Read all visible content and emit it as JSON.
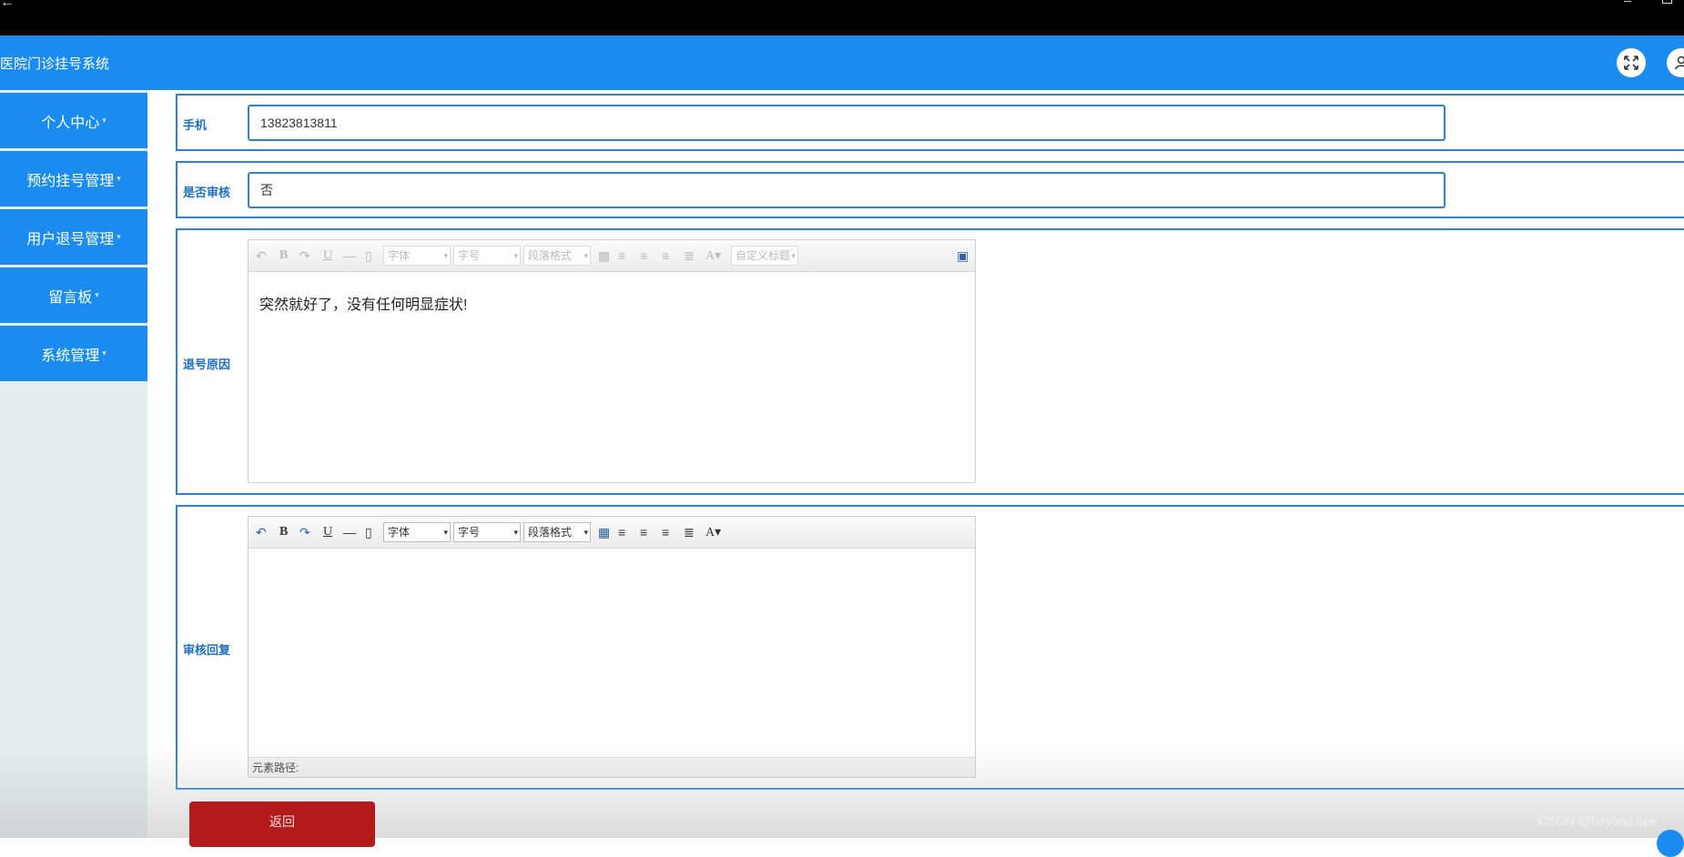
{
  "app": {
    "title": "医院门诊挂号系统"
  },
  "sidebar": {
    "items": [
      {
        "label": "个人中心"
      },
      {
        "label": "预约挂号管理"
      },
      {
        "label": "用户退号管理"
      },
      {
        "label": "留言板"
      },
      {
        "label": "系统管理"
      }
    ]
  },
  "form": {
    "phone": {
      "label": "手机",
      "value": "13823813811"
    },
    "reviewed": {
      "label": "是否审核",
      "value": "否"
    },
    "reason": {
      "label": "退号原因",
      "content": "突然就好了，没有任何明显症状!"
    },
    "reply": {
      "label": "审核回复",
      "content": "",
      "element_path_label": "元素路径:"
    }
  },
  "editor_toolbar": {
    "font": "字体",
    "size": "字号",
    "paragraph": "段落格式",
    "custom_heading": "自定义标题"
  },
  "actions": {
    "back_label": "返回"
  },
  "watermark": "CSDN @beyond.ape",
  "colors": {
    "primary": "#1a8cf0",
    "danger": "#b31b1b",
    "border": "#2d83d2"
  }
}
